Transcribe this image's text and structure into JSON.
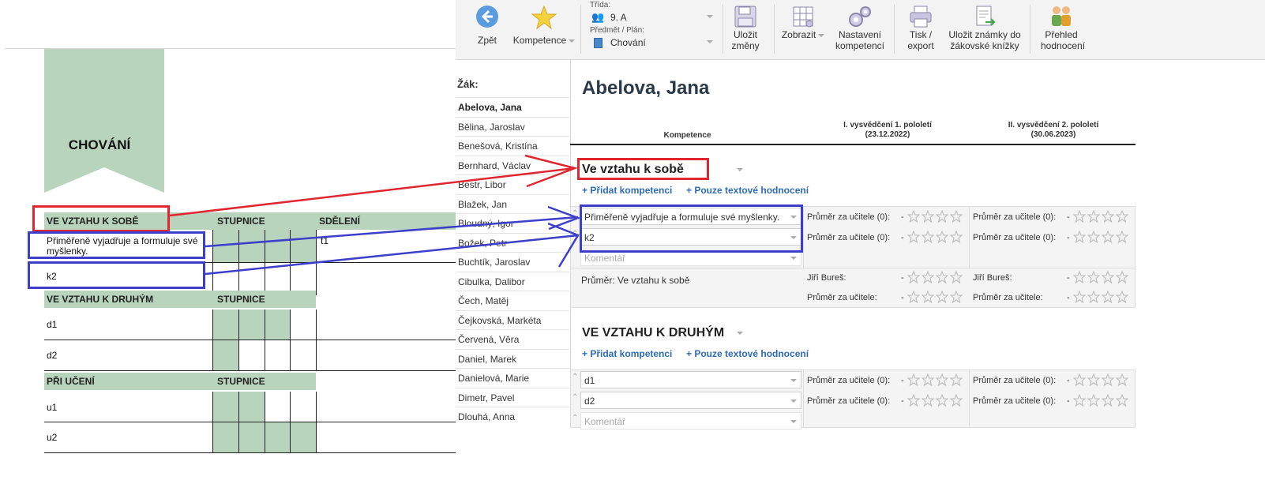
{
  "doc": {
    "title": "CHOVÁNÍ",
    "sections": [
      {
        "header": "VE VZTAHU K SOBĚ",
        "scale_label": "STUPNICE",
        "message_label": "SDĚLENÍ",
        "rows": [
          {
            "label": "Přiměřeně vyjadřuje a formuluje své myšlenky.",
            "filled": 4,
            "note": "t1"
          },
          {
            "label": "k2",
            "filled": 0,
            "note": ""
          }
        ]
      },
      {
        "header": "VE VZTAHU K DRUHÝM",
        "scale_label": "STUPNICE",
        "rows": [
          {
            "label": "d1",
            "filled": 3
          },
          {
            "label": "d2",
            "filled": 1
          }
        ]
      },
      {
        "header": "PŘI UČENÍ",
        "scale_label": "STUPNICE",
        "rows": [
          {
            "label": "u1",
            "filled": 2
          },
          {
            "label": "u2",
            "filled": 4
          }
        ]
      }
    ]
  },
  "toolbar": {
    "back": "Zpět",
    "competence": "Kompetence",
    "class_label": "Třída:",
    "class_value": "9. A",
    "subject_label": "Předmět / Plán:",
    "subject_value": "Chování",
    "save": "Uložit změny",
    "show": "Zobrazit",
    "settings": "Nastavení kompetencí",
    "print": "Tisk / export",
    "save_book": "Uložit známky do žákovské knížky",
    "overview": "Přehled hodnocení"
  },
  "students": {
    "header": "Žák:",
    "items": [
      "Abelova, Jana",
      "Bělina, Jaroslav",
      "Benešová, Kristína",
      "Bernhard, Václav",
      "Bestr, Libor",
      "Blažek, Jan",
      "Bloudný, Igor",
      "Božek, Petr",
      "Buchtík, Jaroslav",
      "Cibulka, Dalibor",
      "Čech, Matěj",
      "Čejkovská, Markéta",
      "Červená, Věra",
      "Daniel, Marek",
      "Danielová, Marie",
      "Dimetr, Pavel",
      "Dlouhá, Anna"
    ],
    "selected": 0
  },
  "main": {
    "student_name": "Abelova, Jana",
    "col_competence": "Kompetence",
    "col_term1": "I. vysvědčení 1. pololetí",
    "col_term1_date": "(23.12.2022)",
    "col_term2": "II. vysvědčení 2. pololetí",
    "col_term2_date": "(30.06.2023)",
    "add_competence": "+ Přidat kompetenci",
    "text_only": "+ Pouze textové hodnocení",
    "teacher_avg": "Průměr za učitele (0):",
    "avg_by_teacher": "Průměr za učitele:",
    "dash": "-",
    "teacher": "Jiří Bureš:",
    "comment_placeholder": "Komentář",
    "section1": {
      "title": "Ve vztahu k sobě",
      "rows": [
        "Přiměřeně vyjadřuje a formuluje své myšlenky.",
        "k2"
      ],
      "average": "Průměr: Ve vztahu k sobě"
    },
    "section2": {
      "title": "VE VZTAHU K DRUHÝM",
      "rows": [
        "d1",
        "d2"
      ]
    }
  },
  "colors": {
    "green": "#b9d4bc",
    "red": "#e0262f",
    "blue": "#3b3fc9",
    "link": "#2d6cb5"
  }
}
